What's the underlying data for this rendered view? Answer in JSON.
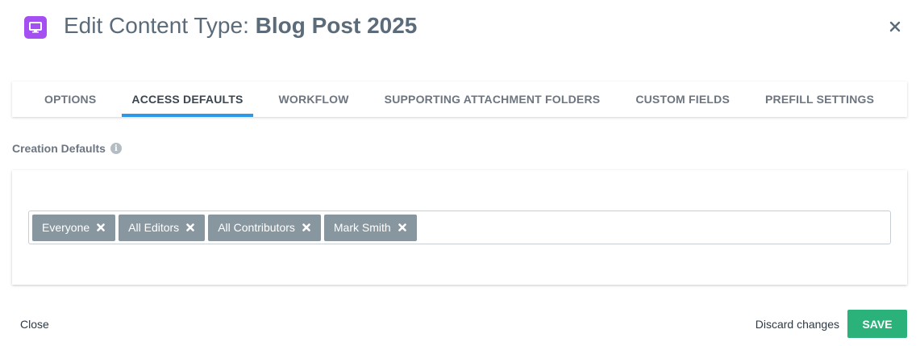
{
  "header": {
    "icon": "monitor-icon",
    "title_prefix": "Edit Content Type: ",
    "title_name": "Blog Post 2025",
    "close_icon": "close-icon"
  },
  "tabs": [
    {
      "label": "OPTIONS",
      "active": false
    },
    {
      "label": "ACCESS DEFAULTS",
      "active": true
    },
    {
      "label": "WORKFLOW",
      "active": false
    },
    {
      "label": "SUPPORTING ATTACHMENT FOLDERS",
      "active": false
    },
    {
      "label": "CUSTOM FIELDS",
      "active": false
    },
    {
      "label": "PREFILL SETTINGS",
      "active": false
    }
  ],
  "section": {
    "label": "Creation Defaults",
    "info_icon": "info-icon"
  },
  "tags": [
    {
      "label": "Everyone"
    },
    {
      "label": "All Editors"
    },
    {
      "label": "All Contributors"
    },
    {
      "label": "Mark Smith"
    }
  ],
  "footer": {
    "close_label": "Close",
    "discard_label": "Discard changes",
    "save_label": "SAVE"
  },
  "colors": {
    "accent": "#2d97e8",
    "icon_bg": "#a44ff2",
    "tag_bg": "#88969f",
    "save_bg": "#2bb27a"
  }
}
